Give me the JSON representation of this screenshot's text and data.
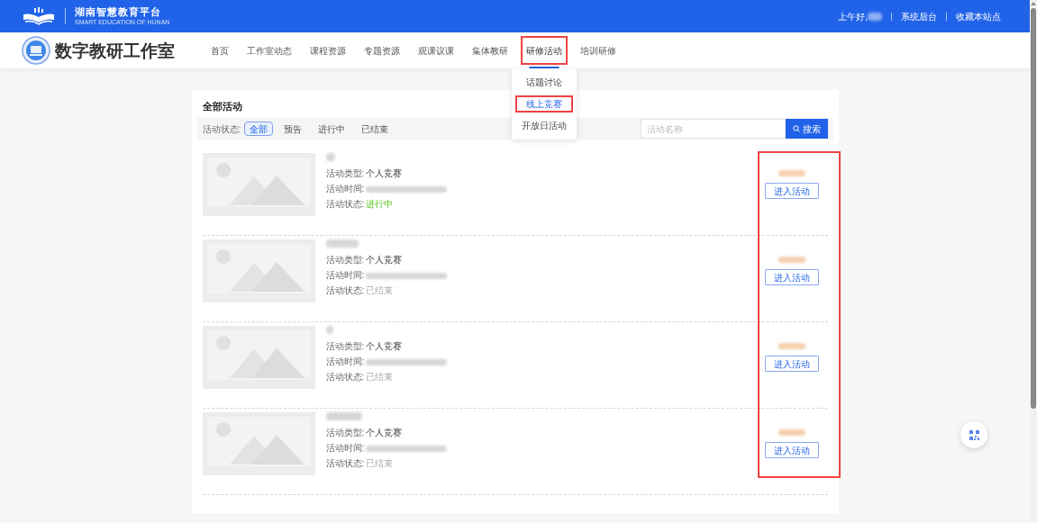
{
  "topbar": {
    "platform_name": "湖南智慧教育平台",
    "platform_subtitle": "SMART EDUCATION OF HUNAN",
    "greeting": "上午好,",
    "links": [
      "系统后台",
      "收藏本站点"
    ]
  },
  "header": {
    "title": "数字教研工作室",
    "nav": [
      {
        "label": "首页",
        "selected": false,
        "highlighted": false
      },
      {
        "label": "工作室动态",
        "selected": false,
        "highlighted": false
      },
      {
        "label": "课程资源",
        "selected": false,
        "highlighted": false
      },
      {
        "label": "专题资源",
        "selected": false,
        "highlighted": false
      },
      {
        "label": "观课议课",
        "selected": false,
        "highlighted": false
      },
      {
        "label": "集体教研",
        "selected": false,
        "highlighted": false
      },
      {
        "label": "研修活动",
        "selected": true,
        "highlighted": true
      },
      {
        "label": "培训研修",
        "selected": false,
        "highlighted": false
      }
    ],
    "dropdown": [
      {
        "label": "话题讨论",
        "selected": false,
        "highlighted": false
      },
      {
        "label": "线上竞赛",
        "selected": true,
        "highlighted": true
      },
      {
        "label": "开放日活动",
        "selected": false,
        "highlighted": false
      }
    ]
  },
  "activities": {
    "title": "全部活动",
    "filter_label": "活动状态:",
    "filters": [
      {
        "label": "全部",
        "selected": true
      },
      {
        "label": "预告",
        "selected": false
      },
      {
        "label": "进行中",
        "selected": false
      },
      {
        "label": "已结束",
        "selected": false
      }
    ],
    "search": {
      "placeholder": "活动名称",
      "button": "搜索"
    },
    "actions_highlighted": true,
    "items": [
      {
        "type_label": "活动类型:",
        "type": "个人竞赛",
        "time_label": "活动时间:",
        "status_label": "活动状态:",
        "status": "进行中",
        "ongoing": true,
        "button": "进入活动"
      },
      {
        "type_label": "活动类型:",
        "type": "个人竞赛",
        "time_label": "活动时间:",
        "status_label": "活动状态:",
        "status": "已结束",
        "ongoing": false,
        "button": "进入活动"
      },
      {
        "type_label": "活动类型:",
        "type": "个人竞赛",
        "time_label": "活动时间:",
        "status_label": "活动状态:",
        "status": "已结束",
        "ongoing": false,
        "button": "进入活动"
      },
      {
        "type_label": "活动类型:",
        "type": "个人竞赛",
        "time_label": "活动时间:",
        "status_label": "活动状态:",
        "status": "已结束",
        "ongoing": false,
        "button": "进入活动"
      }
    ]
  }
}
